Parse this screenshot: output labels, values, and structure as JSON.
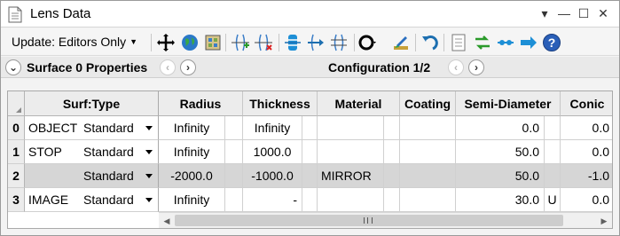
{
  "window": {
    "title": "Lens Data",
    "controls": {
      "menu": "▾",
      "minimize": "—",
      "maximize": "☐",
      "close": "✕"
    }
  },
  "toolbar": {
    "update_label": "Update: Editors Only",
    "icons": [
      "move-icon",
      "globe-icon",
      "map-icon",
      "insert-surface-icon",
      "delete-surface-icon",
      "bolt-icon",
      "arrow-into-icon",
      "tilt-icon",
      "ring-dropdown-icon",
      "paint-icon",
      "undo-icon",
      "notes-icon",
      "double-arrow-icon",
      "link-icon",
      "right-arrow-icon",
      "help-icon"
    ]
  },
  "propbar": {
    "surface_label": "Surface 0 Properties",
    "config_label": "Configuration 1/2"
  },
  "table": {
    "columns": [
      "Surf:Type",
      "Radius",
      "Thickness",
      "Material",
      "Coating",
      "Semi-Diameter",
      "Conic"
    ],
    "rows": [
      {
        "num": "0",
        "comment": "OBJECT",
        "type": "Standard",
        "radius": "Infinity",
        "thickness": "Infinity",
        "material": "",
        "coating": "",
        "semi_diameter": "0.0",
        "semi_flag": "",
        "conic": "0.0"
      },
      {
        "num": "1",
        "comment": "STOP",
        "type": "Standard",
        "radius": "Infinity",
        "thickness": "1000.0",
        "material": "",
        "coating": "",
        "semi_diameter": "50.0",
        "semi_flag": "",
        "conic": "0.0"
      },
      {
        "num": "2",
        "comment": "",
        "type": "Standard",
        "radius": "-2000.0",
        "thickness": "-1000.0",
        "material": "MIRROR",
        "coating": "",
        "semi_diameter": "50.0",
        "semi_flag": "",
        "conic": "-1.0"
      },
      {
        "num": "3",
        "comment": "IMAGE",
        "type": "Standard",
        "radius": "Infinity",
        "thickness": "-",
        "material": "",
        "coating": "",
        "semi_diameter": "30.0",
        "semi_flag": "U",
        "conic": "0.0"
      }
    ]
  },
  "colors": {
    "highlight_row": "#d6d6d6",
    "header_bg": "#ececec",
    "accent_blue": "#1f6fd1"
  }
}
